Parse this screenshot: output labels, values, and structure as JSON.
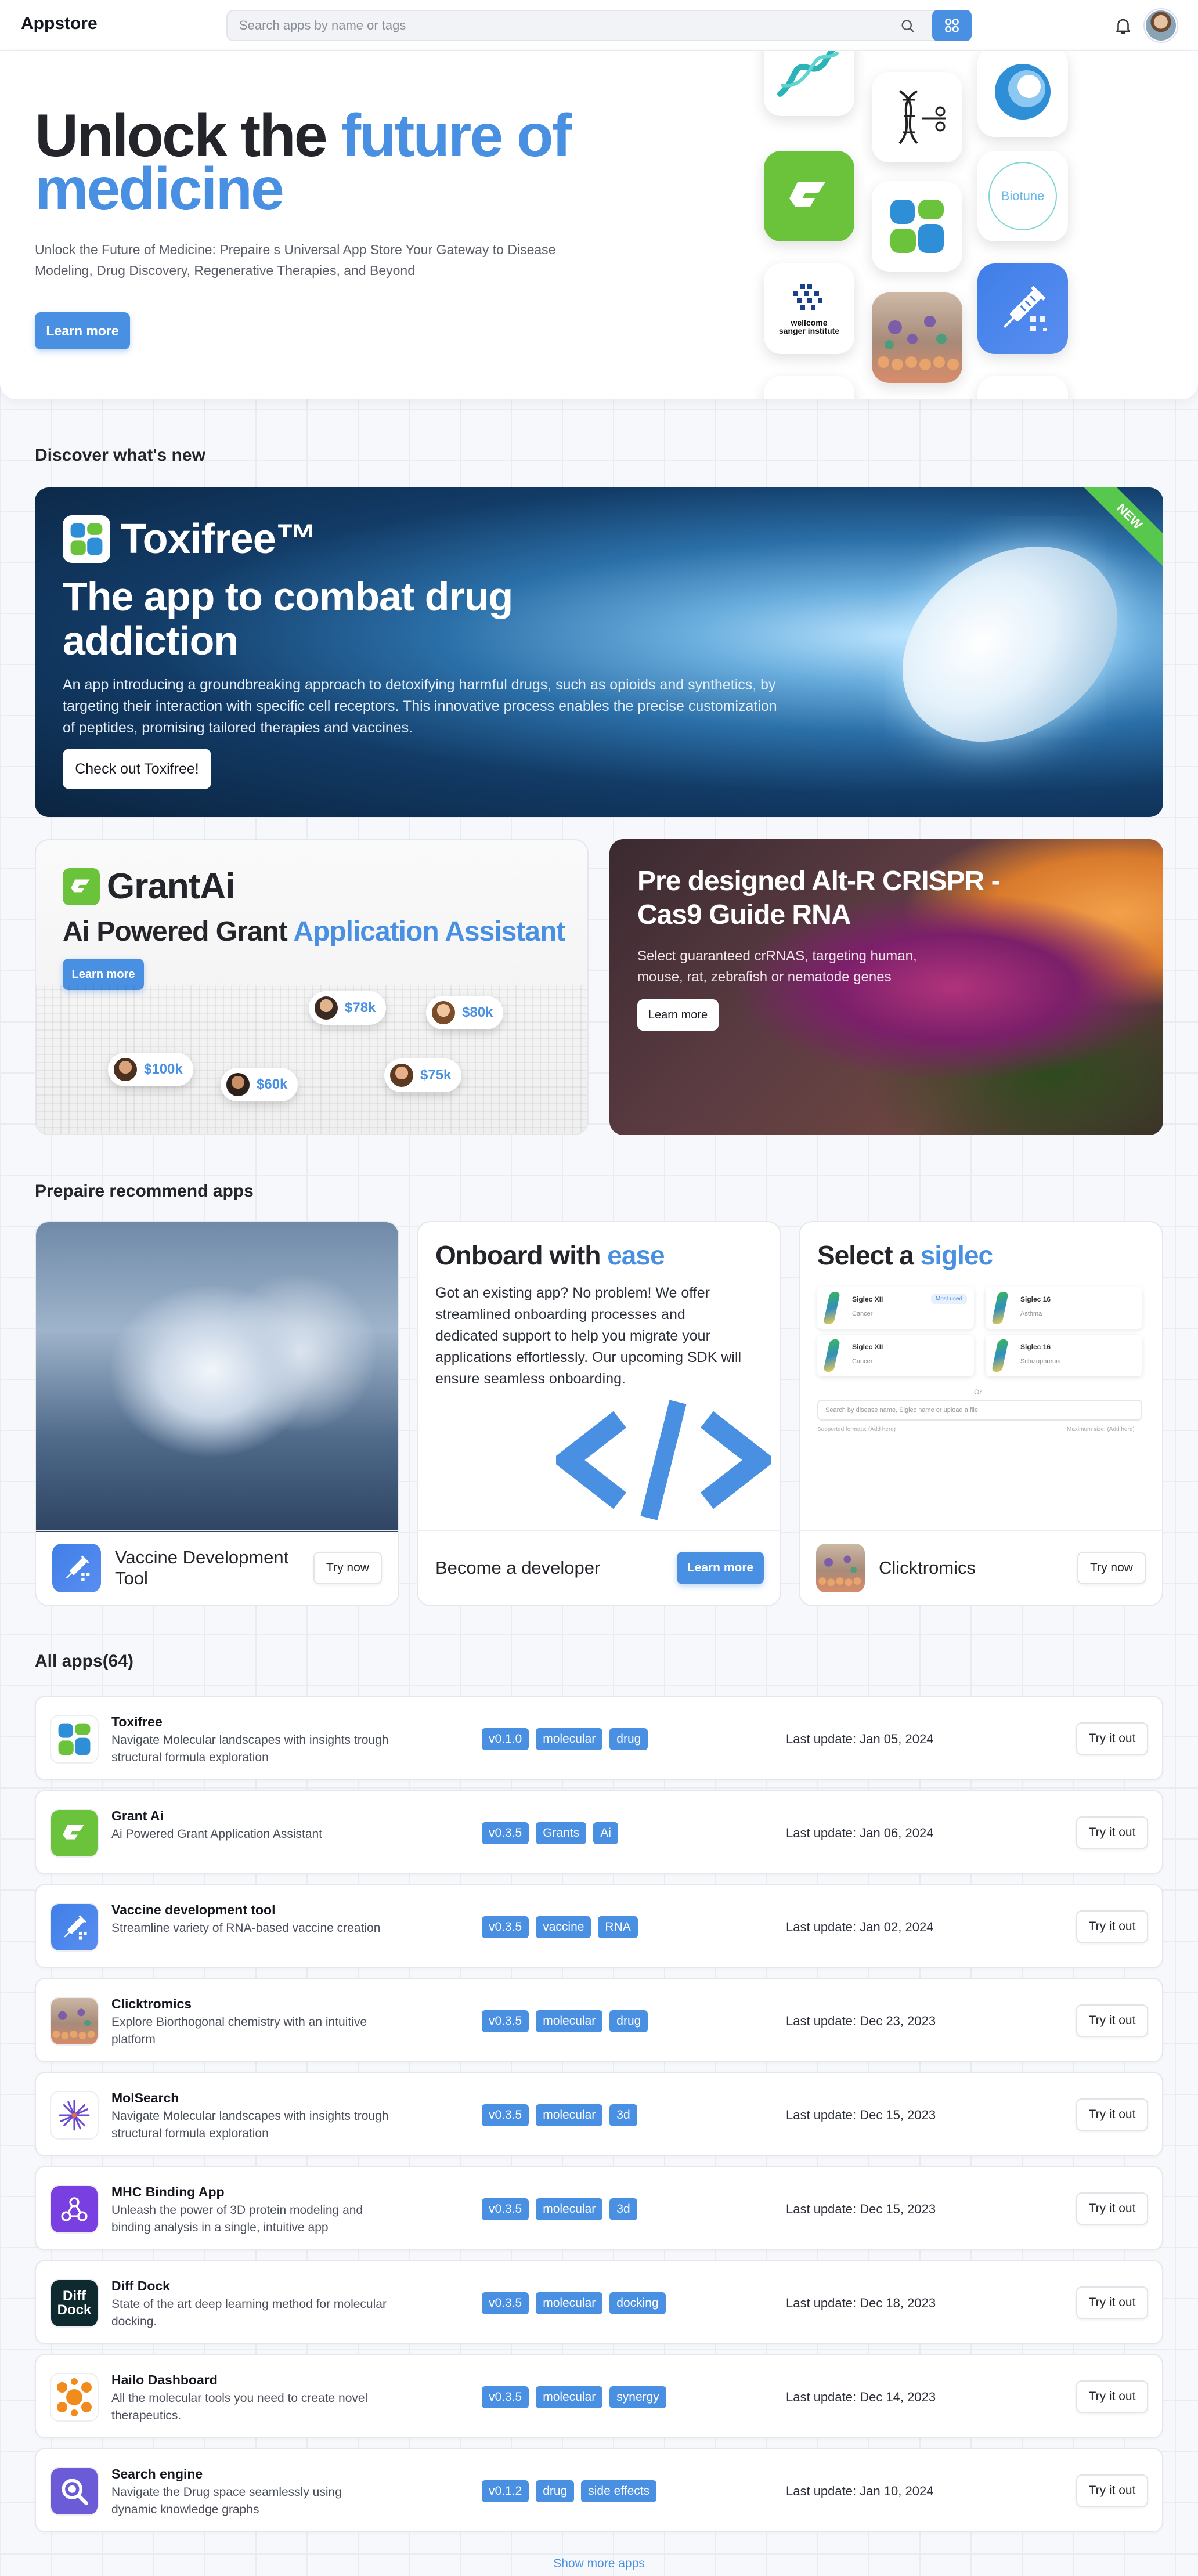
{
  "header": {
    "brand": "Appstore",
    "search_placeholder": "Search apps by name or tags"
  },
  "hero": {
    "title_dark": "Unlock the ",
    "title_blue_1": "future of",
    "title_blue_2": "medicine",
    "subtitle": "Unlock the Future of Medicine: Prepaire s Universal App Store Your Gateway to Disease Modeling, Drug Discovery, Regenerative Therapies, and Beyond",
    "button": "Learn more",
    "biotune_label": "Biotune",
    "sanger_label": "wellcome sanger institute"
  },
  "discover": {
    "title": "Discover what's new",
    "banner": {
      "app_name": "Toxifree™",
      "headline": "The app to combat drug addiction",
      "body": "An app introducing a groundbreaking approach to detoxifying harmful drugs, such as opioids and synthetics, by targeting their interaction with specific cell receptors. This innovative process enables the precise customization of peptides, promising tailored therapies and vaccines.",
      "button": "Check out Toxifree!",
      "ribbon": "NEW"
    },
    "grant": {
      "app_name": "GrantAi",
      "headline_dark": "Ai Powered Grant ",
      "headline_blue": "Application Assistant",
      "button": "Learn more",
      "amounts": [
        "$78k",
        "$80k",
        "$100k",
        "$60k",
        "$75k"
      ]
    },
    "crispr": {
      "headline": "Pre designed Alt-R CRISPR - Cas9 Guide RNA",
      "body": "Select guaranteed crRNAS, targeting human, mouse, rat, zebrafish or nematode genes",
      "button": "Learn more"
    }
  },
  "recommend": {
    "title": "Prepaire recommend apps",
    "vaccine": {
      "name": "Vaccine Development Tool",
      "button": "Try now"
    },
    "onboard": {
      "title_dark": "Onboard with ",
      "title_blue": "ease",
      "body": "Got an existing app? No problem! We offer streamlined onboarding processes and dedicated support to help you migrate your applications effortlessly. Our upcoming SDK will ensure seamless onboarding.",
      "footer_label": "Become a developer",
      "button": "Learn more"
    },
    "siglec": {
      "title_dark": "Select a ",
      "title_blue": "siglec",
      "items": [
        {
          "name": "Siglec XII",
          "sub": "Cancer",
          "badge": "Most used"
        },
        {
          "name": "Siglec 16",
          "sub": "Asthma",
          "badge": ""
        },
        {
          "name": "Siglec XII",
          "sub": "Cancer",
          "badge": ""
        },
        {
          "name": "Siglec 16",
          "sub": "Schizophrenia",
          "badge": ""
        }
      ],
      "or": "Or",
      "input_placeholder": "Search by disease name, Siglec name or upload a file",
      "hint_left": "Supported formats: (Add here)",
      "hint_right": "Maximum size: (Add here)",
      "app_name": "Clicktromics",
      "button": "Try now"
    }
  },
  "all_apps": {
    "title": "All apps(64)",
    "button": "Try it out",
    "show_more": "Show more apps",
    "rows": [
      {
        "name": "Toxifree",
        "desc": "Navigate Molecular landscapes with insights trough structural formula exploration",
        "tags": [
          "v0.1.0",
          "molecular",
          "drug"
        ],
        "update": "Last update: Jan 05, 2024",
        "icon": "toxifree-icon"
      },
      {
        "name": "Grant Ai",
        "desc": "Ai Powered Grant Application Assistant",
        "tags": [
          "v0.3.5",
          "Grants",
          "Ai"
        ],
        "update": "Last update: Jan 06, 2024",
        "icon": "grantai-icon"
      },
      {
        "name": "Vaccine development tool",
        "desc": "Streamline variety of RNA-based vaccine creation",
        "tags": [
          "v0.3.5",
          "vaccine",
          "RNA"
        ],
        "update": "Last update: Jan 02, 2024",
        "icon": "vaccine-icon"
      },
      {
        "name": "Clicktromics",
        "desc": "Explore Biorthogonal chemistry with an intuitive platform",
        "tags": [
          "v0.3.5",
          "molecular",
          "drug"
        ],
        "update": "Last update: Dec 23, 2023",
        "icon": "clicktromics-icon"
      },
      {
        "name": "MolSearch",
        "desc": "Navigate Molecular landscapes with insights trough structural formula exploration",
        "tags": [
          "v0.3.5",
          "molecular",
          "3d"
        ],
        "update": "Last update: Dec 15, 2023",
        "icon": "molsearch-icon"
      },
      {
        "name": "MHC Binding App",
        "desc": "Unleash the power of 3D protein modeling and binding analysis in a single, intuitive app",
        "tags": [
          "v0.3.5",
          "molecular",
          "3d"
        ],
        "update": "Last update: Dec 15, 2023",
        "icon": "mhc-icon"
      },
      {
        "name": "Diff Dock",
        "desc": "State of the art deep learning method for molecular docking.",
        "tags": [
          "v0.3.5",
          "molecular",
          "docking"
        ],
        "update": "Last update: Dec 18, 2023",
        "icon": "diffdock-icon"
      },
      {
        "name": "Hailo Dashboard",
        "desc": "All the molecular tools you need to create novel therapeutics.",
        "tags": [
          "v0.3.5",
          "molecular",
          "synergy"
        ],
        "update": "Last update: Dec 14, 2023",
        "icon": "hailo-icon"
      },
      {
        "name": "Search engine",
        "desc": "Navigate the Drug space seamlessly using dynamic knowledge graphs",
        "tags": [
          "v0.1.2",
          "drug",
          "side effects"
        ],
        "update": "Last update: Jan 10, 2024",
        "icon": "search-engine-icon"
      }
    ]
  },
  "colors": {
    "accent": "#4a90e2",
    "green": "#6ac33a",
    "ribbon": "#57c84d"
  }
}
